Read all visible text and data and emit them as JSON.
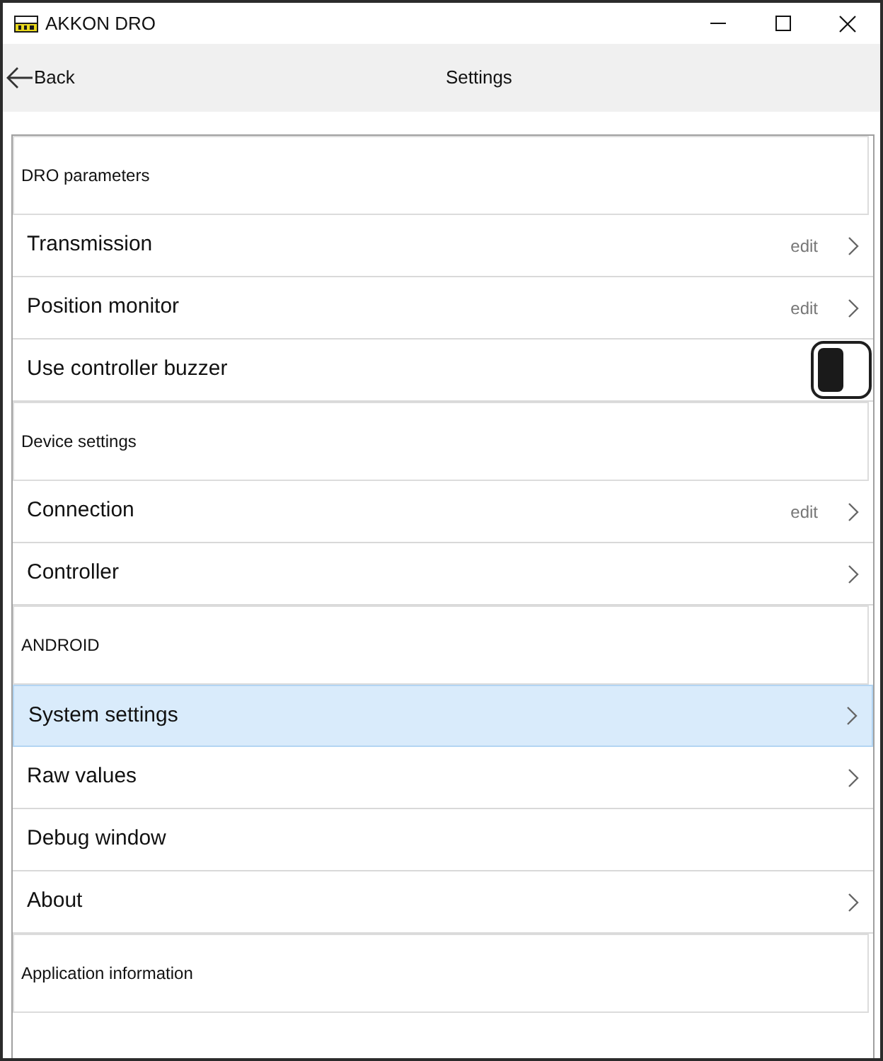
{
  "window": {
    "title": "AKKON DRO"
  },
  "header": {
    "back": "Back",
    "title": "Settings"
  },
  "sections": [
    {
      "title": "DRO parameters",
      "items": [
        {
          "kind": "link",
          "label": "Transmission",
          "hint": "edit",
          "selected": false
        },
        {
          "kind": "link",
          "label": "Position monitor",
          "hint": "edit",
          "selected": false
        },
        {
          "kind": "toggle",
          "label": "Use controller buzzer",
          "on": false,
          "selected": false
        }
      ]
    },
    {
      "title": "Device settings",
      "items": [
        {
          "kind": "link",
          "label": "Connection",
          "hint": "edit",
          "selected": false
        },
        {
          "kind": "link",
          "label": "Controller",
          "selected": false
        }
      ]
    },
    {
      "title": "ANDROID",
      "items": [
        {
          "kind": "link",
          "label": "System settings",
          "selected": true
        },
        {
          "kind": "link",
          "label": "Raw values",
          "selected": false
        },
        {
          "kind": "plain",
          "label": "Debug window",
          "selected": false
        },
        {
          "kind": "link",
          "label": "About",
          "selected": false
        }
      ]
    },
    {
      "title": "Application information"
    }
  ]
}
